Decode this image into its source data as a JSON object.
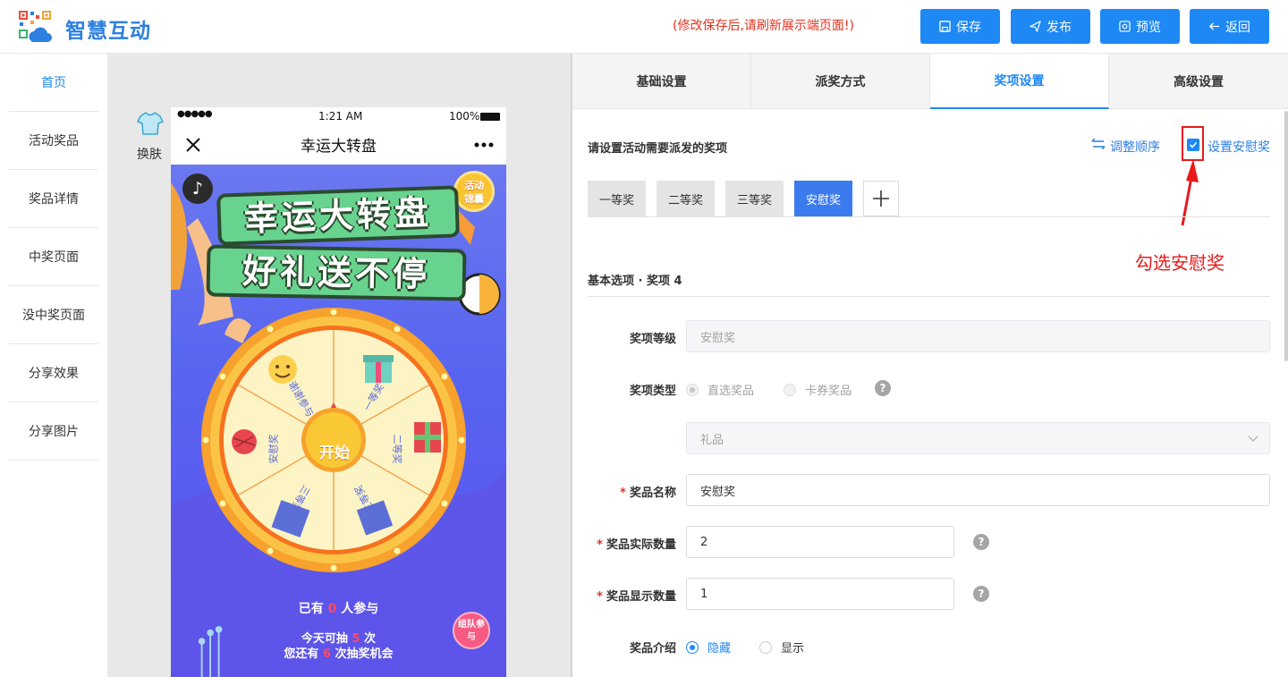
{
  "header": {
    "brand": "智慧互动",
    "notice": "(修改保存后,请刷新展示端页面!)",
    "buttons": {
      "save": "保存",
      "publish": "发布",
      "preview": "预览",
      "back": "返回"
    }
  },
  "sidebar": {
    "items": [
      {
        "label": "首页",
        "active": true
      },
      {
        "label": "活动奖品",
        "active": false
      },
      {
        "label": "奖品详情",
        "active": false
      },
      {
        "label": "中奖页面",
        "active": false
      },
      {
        "label": "没中奖页面",
        "active": false
      },
      {
        "label": "分享效果",
        "active": false
      },
      {
        "label": "分享图片",
        "active": false
      }
    ]
  },
  "preview": {
    "skin_label": "换肤",
    "status": {
      "time": "1:21 AM",
      "battery": "100%"
    },
    "title": "幸运大转盘",
    "badge": "活动锦囊",
    "banner_line1": "幸运大转盘",
    "banner_line2": "好礼送不停",
    "wheel": {
      "start": "开始",
      "segments": [
        "一等奖",
        "二等奖",
        "三等奖",
        "三等奖",
        "安慰奖",
        "谢谢参与"
      ]
    },
    "participants_prefix": "已有",
    "participants_count": "0",
    "participants_suffix": "人参与",
    "today_prefix": "今天可抽",
    "today_count": "5",
    "today_suffix": "次",
    "remain_prefix": "您还有",
    "remain_count": "6",
    "remain_suffix": "次抽奖机会",
    "team_badge": "组队参与"
  },
  "panel": {
    "tabs": [
      {
        "label": "基础设置",
        "active": false
      },
      {
        "label": "派奖方式",
        "active": false
      },
      {
        "label": "奖项设置",
        "active": true
      },
      {
        "label": "高级设置",
        "active": false
      }
    ],
    "section_title": "请设置活动需要派发的奖项",
    "reorder_link": "调整顺序",
    "consolation_checkbox": {
      "label": "设置安慰奖",
      "checked": true
    },
    "prize_tabs": [
      {
        "label": "一等奖",
        "active": false
      },
      {
        "label": "二等奖",
        "active": false
      },
      {
        "label": "三等奖",
        "active": false
      },
      {
        "label": "安慰奖",
        "active": true
      }
    ],
    "annotation": "勾选安慰奖",
    "basic_title": "基本选项 · 奖项 4",
    "fields": {
      "level_label": "奖项等级",
      "level_value": "安慰奖",
      "type_label": "奖项类型",
      "type_options": [
        "直选奖品",
        "卡券奖品"
      ],
      "category_value": "礼品",
      "name_label": "奖品名称",
      "name_value": "安慰奖",
      "actual_qty_label": "奖品实际数量",
      "actual_qty_value": "2",
      "display_qty_label": "奖品显示数量",
      "display_qty_value": "1",
      "intro_label": "奖品介绍",
      "intro_options": [
        "隐藏",
        "显示"
      ]
    }
  }
}
